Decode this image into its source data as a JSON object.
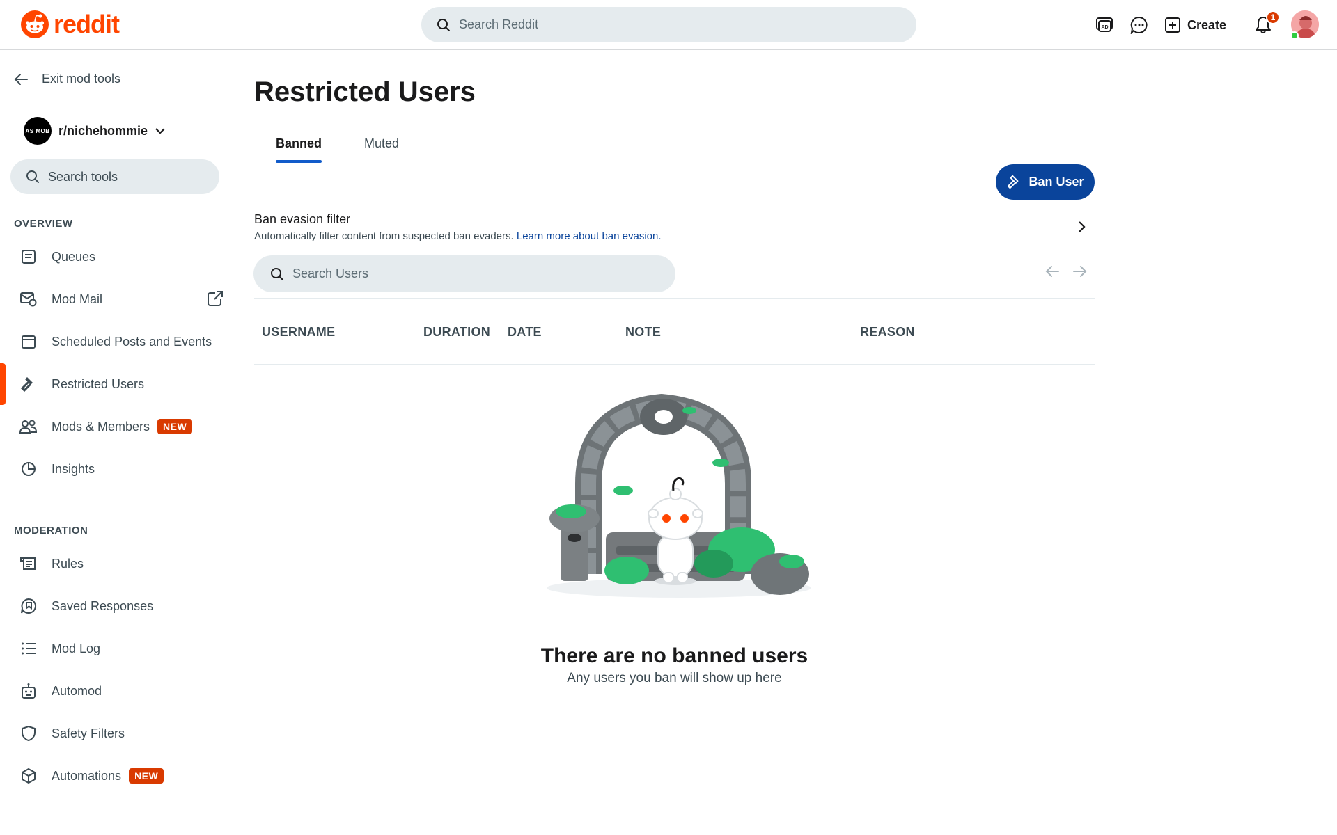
{
  "header": {
    "logo_text": "reddit",
    "search_placeholder": "Search Reddit",
    "create_label": "Create",
    "notification_count": "1",
    "icons": [
      "advertise-icon",
      "chat-icon",
      "create-plus-icon",
      "bell-icon"
    ]
  },
  "sidebar": {
    "exit_label": "Exit mod tools",
    "community_name": "r/nichehommie",
    "community_avatar_text": "AS MOB",
    "search_placeholder": "Search tools",
    "overview_label": "OVERVIEW",
    "moderation_label": "MODERATION",
    "overview_items": [
      {
        "label": "Queues",
        "icon": "queue-icon"
      },
      {
        "label": "Mod Mail",
        "icon": "modmail-icon"
      },
      {
        "label": "Scheduled Posts and Events",
        "icon": "calendar-icon"
      },
      {
        "label": "Restricted Users",
        "icon": "hammer-icon",
        "active": true
      },
      {
        "label": "Mods & Members",
        "icon": "members-icon",
        "badge": "NEW"
      },
      {
        "label": "Insights",
        "icon": "insights-icon"
      }
    ],
    "moderation_items": [
      {
        "label": "Rules",
        "icon": "rules-icon"
      },
      {
        "label": "Saved Responses",
        "icon": "saved-responses-icon"
      },
      {
        "label": "Mod Log",
        "icon": "list-icon"
      },
      {
        "label": "Automod",
        "icon": "robot-icon"
      },
      {
        "label": "Safety Filters",
        "icon": "shield-icon"
      },
      {
        "label": "Automations",
        "icon": "cube-icon",
        "badge": "NEW"
      }
    ]
  },
  "main": {
    "title": "Restricted Users",
    "tabs": [
      {
        "label": "Banned",
        "active": true
      },
      {
        "label": "Muted",
        "active": false
      }
    ],
    "ban_button_label": "Ban User",
    "evasion_title": "Ban evasion filter",
    "evasion_desc": "Automatically filter content from suspected ban evaders.",
    "evasion_link": "Learn more about ban evasion.",
    "search_placeholder": "Search Users",
    "columns": [
      "USERNAME",
      "DURATION",
      "DATE",
      "NOTE",
      "REASON"
    ],
    "empty_title": "There are no banned users",
    "empty_subtitle": "Any users you ban will show up here"
  },
  "colors": {
    "brand": "#ff4500",
    "button_blue": "#0a449b",
    "tab_underline": "#115bca",
    "badge_red": "#d93a00",
    "search_bg": "#e5ebee"
  }
}
